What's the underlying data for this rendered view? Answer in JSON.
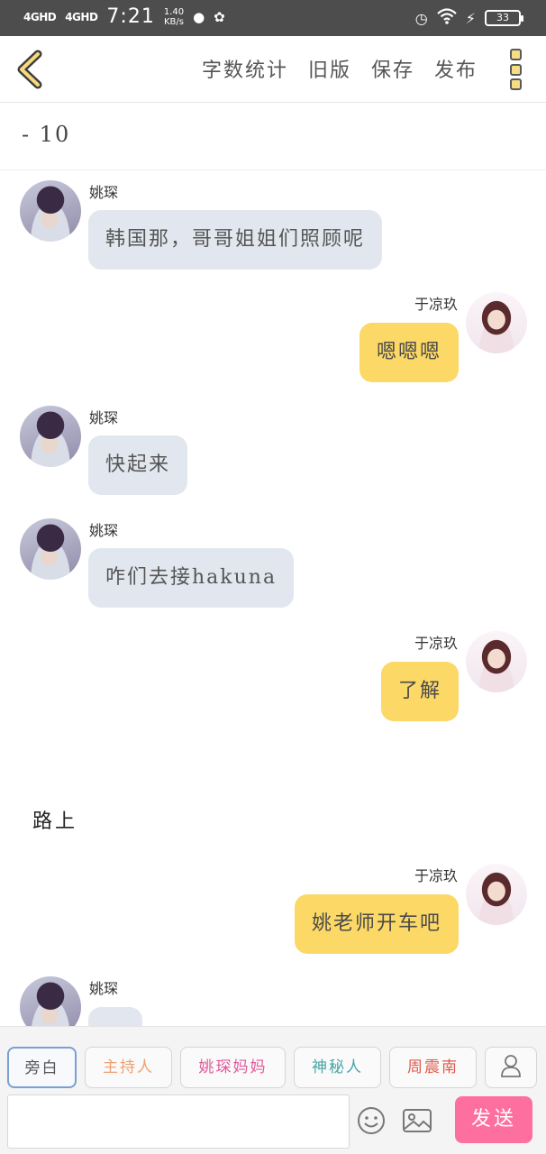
{
  "status_bar": {
    "signal1": "4GHD",
    "signal2": "4GHD",
    "time": "7:21",
    "speed_value": "1.40",
    "speed_unit": "KB/s",
    "battery": "33"
  },
  "topbar": {
    "word_count": "字数统计",
    "old_version": "旧版",
    "save": "保存",
    "publish": "发布"
  },
  "chapter_title": "- 10",
  "messages": [
    {
      "side": "left",
      "sender": "姚琛",
      "text": "韩国那，哥哥姐姐们照顾呢"
    },
    {
      "side": "right",
      "sender": "于凉玖",
      "text": "嗯嗯嗯"
    },
    {
      "side": "left",
      "sender": "姚琛",
      "text": "快起来"
    },
    {
      "side": "left",
      "sender": "姚琛",
      "text": "咋们去接hakuna"
    },
    {
      "side": "right",
      "sender": "于凉玖",
      "text": "了解"
    },
    {
      "side": "narration",
      "text": "路上"
    },
    {
      "side": "right",
      "sender": "于凉玖",
      "text": "姚老师开车吧"
    },
    {
      "side": "left",
      "sender": "姚琛",
      "text": ""
    }
  ],
  "roles": [
    {
      "label": "旁白",
      "color": "#555555"
    },
    {
      "label": "主持人",
      "color": "#f0a070"
    },
    {
      "label": "姚琛妈妈",
      "color": "#e05a9a"
    },
    {
      "label": "神秘人",
      "color": "#46a6a6"
    },
    {
      "label": "周震南",
      "color": "#e05a4a"
    }
  ],
  "input": {
    "placeholder": ""
  },
  "send_label": "发送",
  "colors": {
    "left_bubble": "#e2e7ef",
    "right_bubble": "#fcd867",
    "send_button": "#fd6f9e",
    "status_bar": "#4d4d4d"
  },
  "icons": {
    "back": "chevron-left-icon",
    "more": "more-vertical-icon",
    "user": "user-icon",
    "emoji": "emoji-icon",
    "image": "image-icon"
  }
}
